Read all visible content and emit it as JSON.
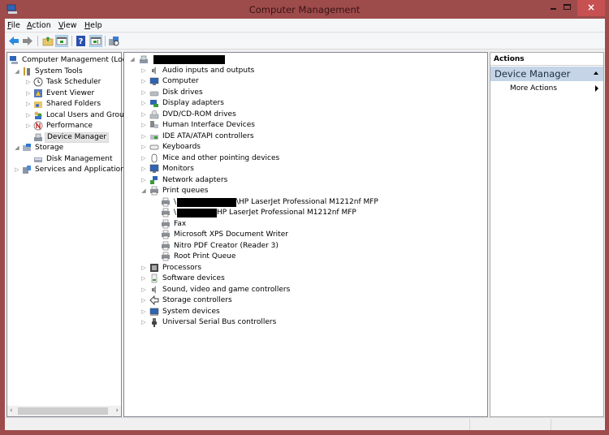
{
  "window": {
    "title": "Computer Management",
    "close_glyph": "×"
  },
  "menu": [
    {
      "label": "File",
      "accel": "F",
      "rest": "ile"
    },
    {
      "label": "Action",
      "accel": "A",
      "rest": "ction"
    },
    {
      "label": "View",
      "accel": "V",
      "rest": "iew"
    },
    {
      "label": "Help",
      "accel": "H",
      "rest": "elp"
    }
  ],
  "toolbar": [
    {
      "name": "back-button",
      "icon": "arrow-left-icon"
    },
    {
      "name": "forward-button",
      "icon": "arrow-right-icon"
    },
    {
      "name": "up-one-level-button",
      "icon": "folder-up-icon"
    },
    {
      "name": "show-hide-console-tree-button",
      "icon": "console-tree-icon",
      "pressed": true
    },
    {
      "name": "help-button",
      "icon": "help-icon"
    },
    {
      "name": "show-hide-action-pane-button",
      "icon": "action-pane-icon",
      "pressed": true
    },
    {
      "name": "scan-hardware-button",
      "icon": "scan-hardware-icon"
    }
  ],
  "left_tree": [
    {
      "label": "Computer Management (Local",
      "level": 0,
      "expander": "",
      "icon": "computer-management-icon"
    },
    {
      "label": "System Tools",
      "level": 1,
      "expander": "expanded",
      "icon": "system-tools-icon"
    },
    {
      "label": "Task Scheduler",
      "level": 2,
      "expander": "collapsed",
      "icon": "task-scheduler-icon"
    },
    {
      "label": "Event Viewer",
      "level": 2,
      "expander": "collapsed",
      "icon": "event-viewer-icon"
    },
    {
      "label": "Shared Folders",
      "level": 2,
      "expander": "collapsed",
      "icon": "shared-folders-icon"
    },
    {
      "label": "Local Users and Groups",
      "level": 2,
      "expander": "collapsed",
      "icon": "local-users-icon"
    },
    {
      "label": "Performance",
      "level": 2,
      "expander": "collapsed",
      "icon": "performance-icon"
    },
    {
      "label": "Device Manager",
      "level": 2,
      "expander": "",
      "icon": "device-manager-icon",
      "selected": true
    },
    {
      "label": "Storage",
      "level": 1,
      "expander": "expanded",
      "icon": "storage-icon"
    },
    {
      "label": "Disk Management",
      "level": 2,
      "expander": "",
      "icon": "disk-management-icon"
    },
    {
      "label": "Services and Applications",
      "level": 1,
      "expander": "collapsed",
      "icon": "services-icon"
    }
  ],
  "device_tree": {
    "root_label": "",
    "categories": [
      {
        "label": "Audio inputs and outputs",
        "icon": "speaker-icon"
      },
      {
        "label": "Computer",
        "icon": "computer-icon"
      },
      {
        "label": "Disk drives",
        "icon": "disk-drive-icon"
      },
      {
        "label": "Display adapters",
        "icon": "display-adapter-icon"
      },
      {
        "label": "DVD/CD-ROM drives",
        "icon": "dvd-drive-icon"
      },
      {
        "label": "Human Interface Devices",
        "icon": "hid-icon"
      },
      {
        "label": "IDE ATA/ATAPI controllers",
        "icon": "ide-controller-icon"
      },
      {
        "label": "Keyboards",
        "icon": "keyboard-icon"
      },
      {
        "label": "Mice and other pointing devices",
        "icon": "mouse-icon"
      },
      {
        "label": "Monitors",
        "icon": "monitor-icon"
      },
      {
        "label": "Network adapters",
        "icon": "network-adapter-icon"
      },
      {
        "label": "Print queues",
        "icon": "printer-icon",
        "expanded": true
      },
      {
        "label": "Processors",
        "icon": "processor-icon"
      },
      {
        "label": "Software devices",
        "icon": "software-device-icon"
      },
      {
        "label": "Sound, video and game controllers",
        "icon": "speaker-icon"
      },
      {
        "label": "Storage controllers",
        "icon": "storage-controller-icon"
      },
      {
        "label": "System devices",
        "icon": "system-device-icon"
      },
      {
        "label": "Universal Serial Bus controllers",
        "icon": "usb-icon"
      }
    ],
    "print_queues": [
      {
        "prefix": "\\",
        "label": "\\HP LaserJet Professional M1212nf MFP",
        "redacted": true
      },
      {
        "prefix": "\\",
        "label": "HP LaserJet Professional M1212nf MFP",
        "redacted": true
      },
      {
        "prefix": "",
        "label": "Fax"
      },
      {
        "prefix": "",
        "label": "Microsoft XPS Document Writer"
      },
      {
        "prefix": "",
        "label": "Nitro PDF Creator (Reader 3)"
      },
      {
        "prefix": "",
        "label": "Root Print Queue"
      }
    ]
  },
  "actions": {
    "header": "Actions",
    "group": "Device Manager",
    "items": [
      "More Actions"
    ]
  },
  "scrollbar": {
    "left_glyph": "‹",
    "right_glyph": "›"
  },
  "colors": {
    "titlebar": "#9e4b4c",
    "close_button": "#c75050",
    "action_group": "#c5d5e7",
    "selection": "#e5e5e5"
  }
}
